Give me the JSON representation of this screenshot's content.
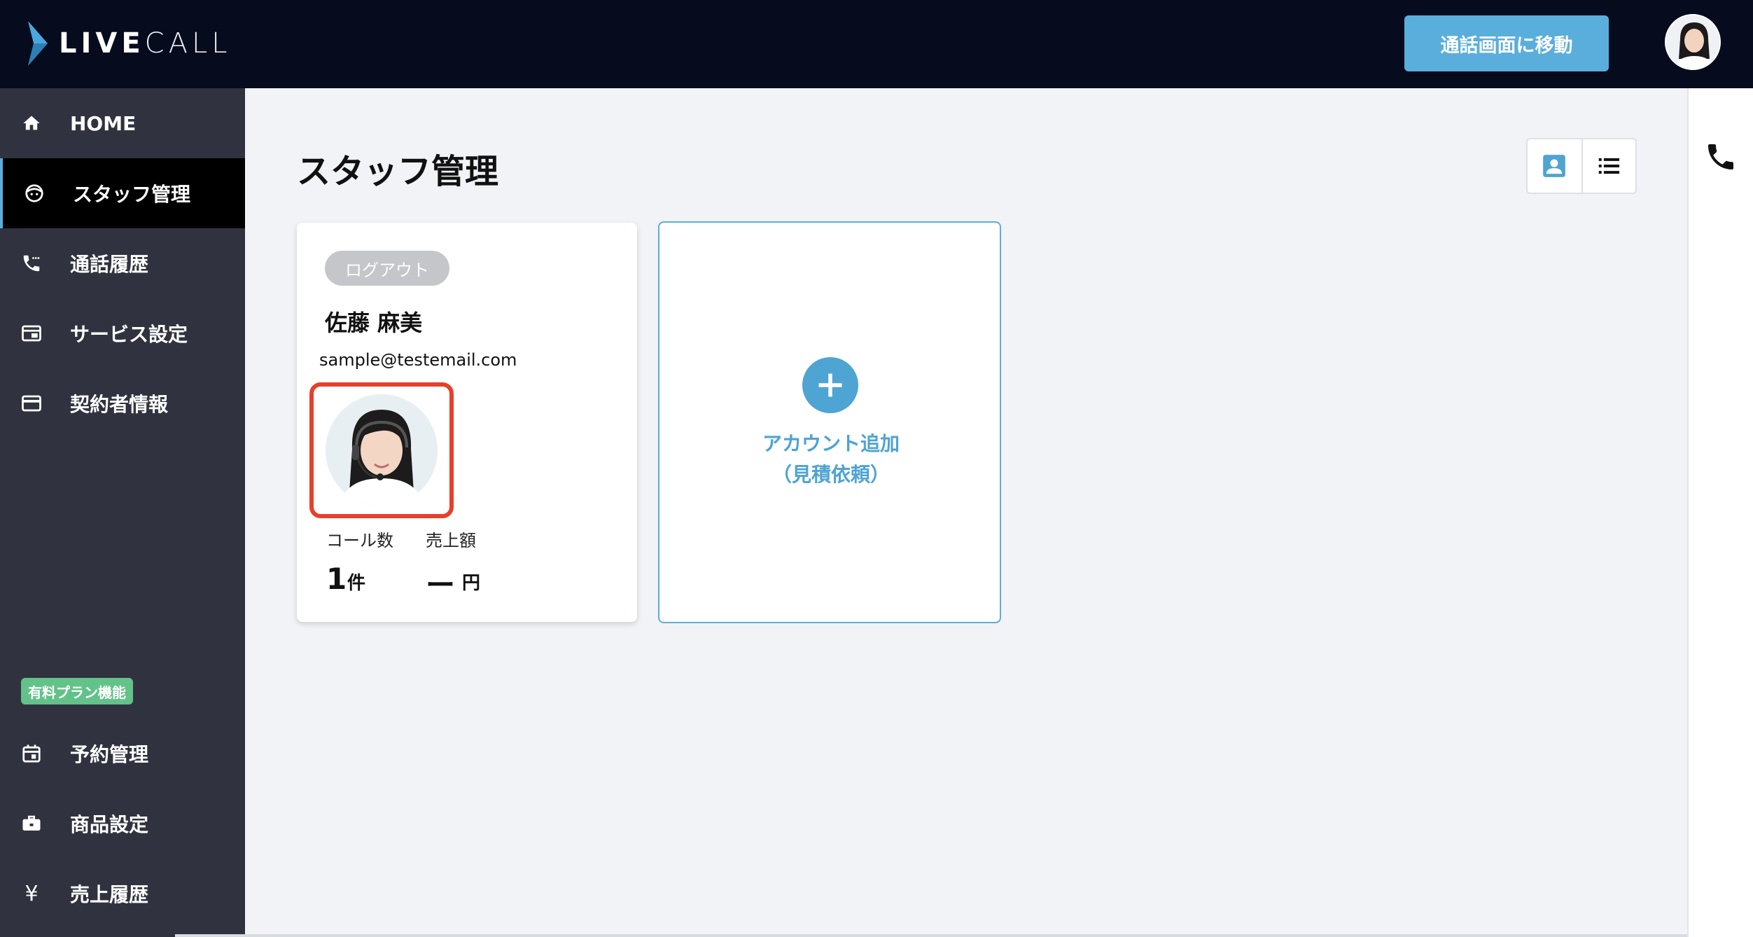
{
  "app": {
    "logo_text_bold": "LIVE",
    "logo_text_light": "CALL"
  },
  "header": {
    "move_button": "通話画面に移動",
    "avatar_icon": "user-avatar"
  },
  "sidebar": {
    "items": [
      {
        "label": "HOME",
        "icon": "home-icon",
        "active": false
      },
      {
        "label": "スタッフ管理",
        "icon": "face-icon",
        "active": true
      },
      {
        "label": "通話履歴",
        "icon": "phone-history-icon",
        "active": false
      },
      {
        "label": "サービス設定",
        "icon": "service-icon",
        "active": false
      },
      {
        "label": "契約者情報",
        "icon": "card-icon",
        "active": false
      }
    ],
    "plan_badge": "有料プラン機能",
    "paid_items": [
      {
        "label": "予約管理",
        "icon": "calendar-icon"
      },
      {
        "label": "商品設定",
        "icon": "briefcase-icon"
      },
      {
        "label": "売上履歴",
        "icon": "yen-icon"
      }
    ]
  },
  "main": {
    "title": "スタッフ管理",
    "view_toggle": [
      "card-view-icon",
      "list-view-icon"
    ],
    "staff": {
      "status": "ログアウト",
      "name": "佐藤 麻美",
      "email": "sample@testemail.com",
      "calls_label": "コール数",
      "calls_value": "1",
      "calls_unit": "件",
      "sales_label": "売上額",
      "sales_value": "ー",
      "sales_unit": "円"
    },
    "add_card": {
      "line1": "アカウント追加",
      "line2": "（見積依頼）"
    }
  },
  "colors": {
    "header_bg": "#060b1e",
    "sidebar_bg": "#30333f",
    "accent": "#5aaedb",
    "highlight": "#e5402b",
    "badge": "#62c289"
  }
}
